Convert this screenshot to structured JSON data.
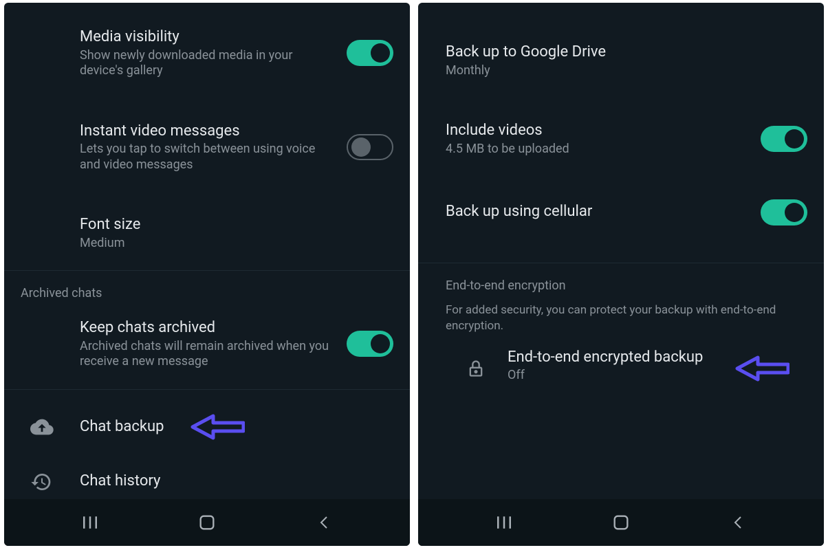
{
  "left": {
    "media_visibility": {
      "title": "Media visibility",
      "sub": "Show newly downloaded media in your device's gallery",
      "on": true
    },
    "instant_video": {
      "title": "Instant video messages",
      "sub": "Lets you tap to switch between using voice and video messages",
      "on": false
    },
    "font_size": {
      "title": "Font size",
      "sub": "Medium"
    },
    "archived_header": "Archived chats",
    "keep_archived": {
      "title": "Keep chats archived",
      "sub": "Archived chats will remain archived when you receive a new message",
      "on": true
    },
    "chat_backup": "Chat backup",
    "chat_history": "Chat history"
  },
  "right": {
    "gdrive": {
      "title": "Back up to Google Drive",
      "sub": "Monthly"
    },
    "include_videos": {
      "title": "Include videos",
      "sub": "4.5 MB to be uploaded",
      "on": true
    },
    "cellular": {
      "title": "Back up using cellular",
      "on": true
    },
    "e2e_header": "End-to-end encryption",
    "e2e_desc": "For added security, you can protect your backup with end-to-end encryption.",
    "e2e_backup": {
      "title": "End-to-end encrypted backup",
      "sub": "Off"
    }
  }
}
